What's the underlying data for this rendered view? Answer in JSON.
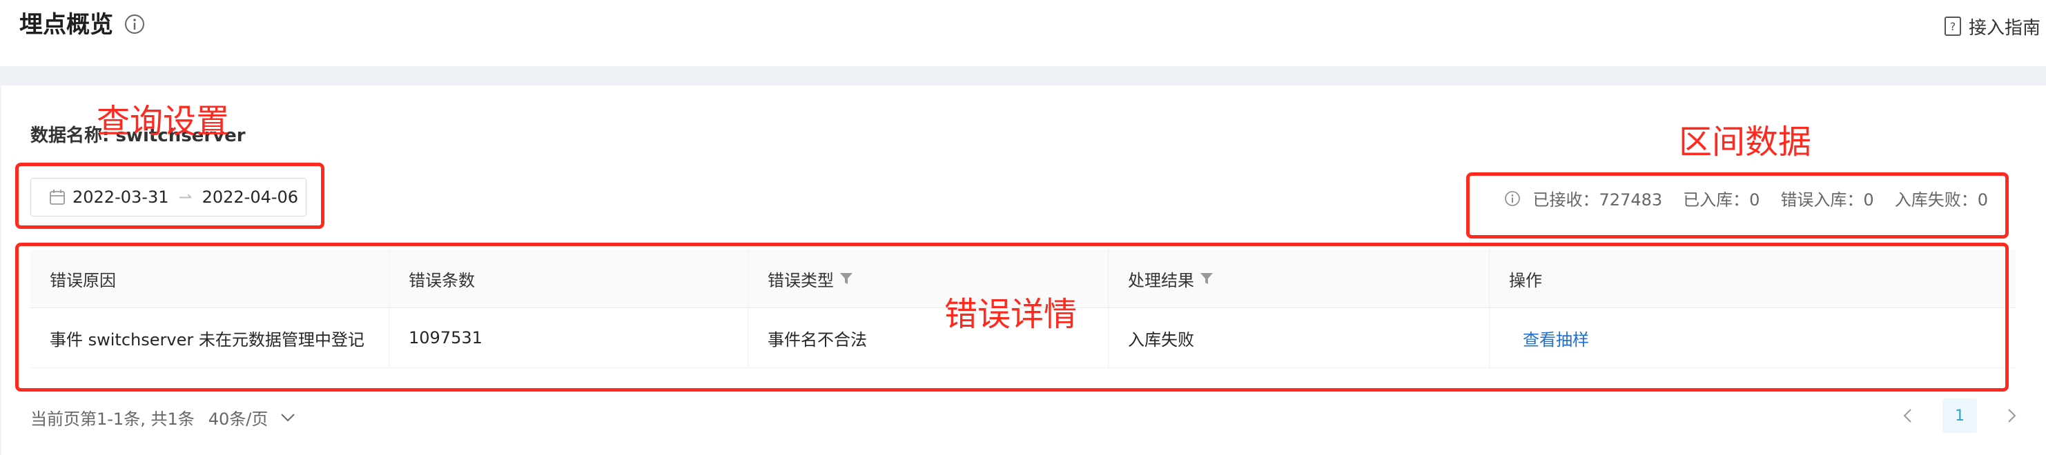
{
  "header": {
    "title": "埋点概览",
    "guide_label": "接入指南"
  },
  "query": {
    "data_name_label": "数据名称: switchserver",
    "start_date": "2022-03-31",
    "end_date": "2022-04-06"
  },
  "stats": [
    {
      "label": "已接收：727483"
    },
    {
      "label": "已入库：0"
    },
    {
      "label": "错误入库：0"
    },
    {
      "label": "入库失败：0"
    }
  ],
  "table": {
    "headers": [
      "错误原因",
      "错误条数",
      "错误类型",
      "处理结果",
      "操作"
    ],
    "rows": [
      [
        "事件 switchserver 未在元数据管理中登记",
        "1097531",
        "事件名不合法",
        "入库失败",
        "查看抽样"
      ]
    ]
  },
  "pagination": {
    "summary": "当前页第1-1条, 共1条",
    "page_size": "40条/页",
    "current_page": "1"
  },
  "annotations": {
    "query": "查询设置",
    "range_data": "区间数据",
    "error_detail": "错误详情"
  },
  "colors": {
    "annotation": "#ff2a1f",
    "link": "#1f6fd6",
    "page_active": "#2ba3c7"
  }
}
